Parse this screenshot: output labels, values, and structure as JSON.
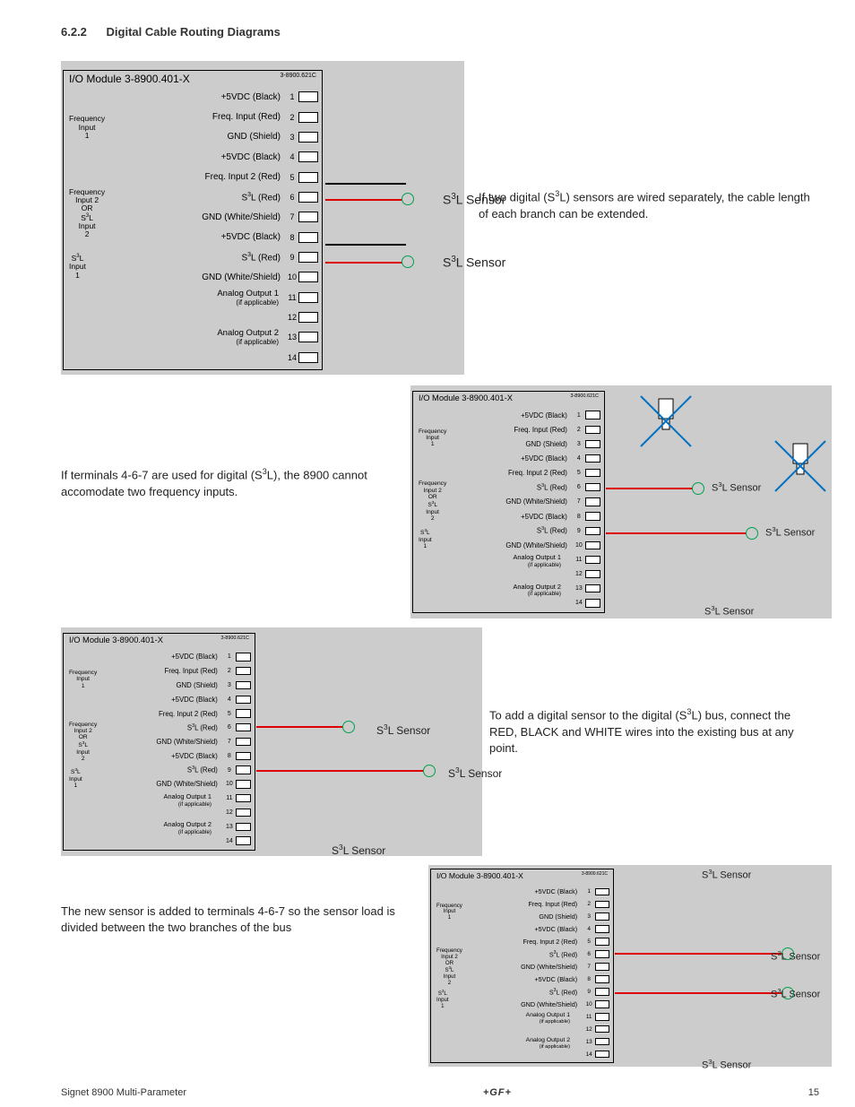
{
  "section": {
    "number": "6.2.2",
    "title": "Digital Cable Routing Diagrams"
  },
  "module_header": {
    "title": "I/O Module 3-8900.401-X",
    "partno": "3-8900.621C"
  },
  "terminal_rows": [
    {
      "n": "1",
      "label": "+5VDC (Black)"
    },
    {
      "n": "2",
      "label": "Freq. Input (Red)"
    },
    {
      "n": "3",
      "label": "GND (Shield)"
    },
    {
      "n": "4",
      "label": "+5VDC (Black)"
    },
    {
      "n": "5",
      "label": "Freq. Input 2 (Red)"
    },
    {
      "n": "6",
      "label": "S³L (Red)"
    },
    {
      "n": "7",
      "label": "GND (White/Shield)"
    },
    {
      "n": "8",
      "label": "+5VDC (Black)"
    },
    {
      "n": "9",
      "label": "S³L (Red)"
    },
    {
      "n": "10",
      "label": "GND (White/Shield)"
    },
    {
      "n": "11",
      "label": ""
    },
    {
      "n": "12",
      "label": ""
    },
    {
      "n": "13",
      "label": ""
    },
    {
      "n": "14",
      "label": ""
    }
  ],
  "left_groups": [
    {
      "top_ratio": 0.1,
      "text": "Frequency\nInput\n1"
    },
    {
      "top_ratio": 0.36,
      "text": "Frequency\nInput 2\nOR\nS³L\nInput\n2"
    },
    {
      "top_ratio": 0.595,
      "text": "S³L\nInput\n1"
    }
  ],
  "analog_outputs": [
    {
      "label": "Analog Output 1",
      "sub": "(if applicable)"
    },
    {
      "label": "Analog Output 2",
      "sub": "(if applicable)"
    }
  ],
  "annotations": {
    "a1": "If two digital (S³L) sensors are wired separately, the cable length of each branch can be extended.",
    "a2": "If terminals 4-6-7 are used for digital (S³L), the 8900 cannot accomodate two frequency inputs.",
    "a3": "To add a digital sensor to the digital (S³L) bus, connect the RED, BLACK and WHITE wires into the existing bus at any point.",
    "a4": "The new sensor is added to terminals 4-6-7 so the sensor load is divided between the two branches of the bus"
  },
  "sensor_label": "S³L Sensor",
  "footer": {
    "left": "Signet 8900 Multi-Parameter",
    "brand": "+GF+",
    "page": "15"
  },
  "diagrams": {
    "d1": {
      "sensor_count": 2
    },
    "d2": {
      "sensor_count": 3,
      "blocked_freq_inputs": true
    },
    "d3": {
      "sensor_count": 3
    },
    "d4": {
      "sensor_count": 4
    }
  }
}
